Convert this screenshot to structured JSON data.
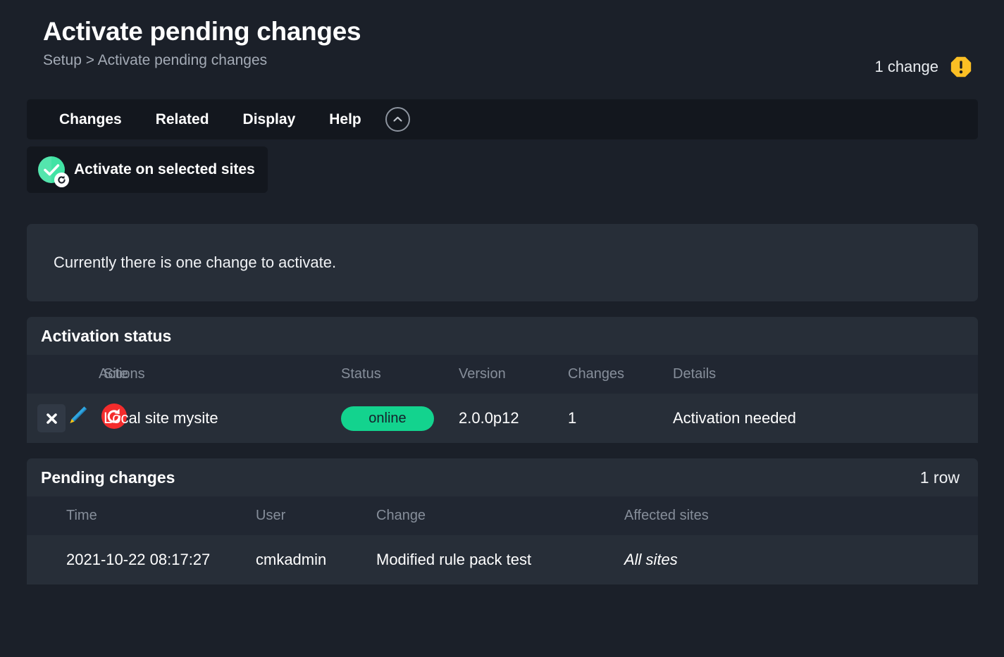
{
  "header": {
    "title": "Activate pending changes",
    "breadcrumb": "Setup > Activate pending changes",
    "change_count": "1 change",
    "warning_icon": "warning-octagon-icon",
    "warning_color": "#fbbf24"
  },
  "menu": {
    "items": [
      {
        "label": "Changes"
      },
      {
        "label": "Related"
      },
      {
        "label": "Display"
      },
      {
        "label": "Help"
      }
    ],
    "collapse_icon": "chevron-up-circle-icon"
  },
  "toolbar": {
    "activate_label": "Activate on selected sites",
    "activate_icon": "activate-check-reload-icon",
    "activate_icon_color": "#41e3a4"
  },
  "info": {
    "message": "Currently there is one change to activate."
  },
  "activation_status": {
    "title": "Activation status",
    "columns": [
      "Actions",
      "Site",
      "Status",
      "Version",
      "Changes",
      "Details"
    ],
    "rows": [
      {
        "delete_icon": "close-x-icon",
        "edit_icon": "pencil-icon",
        "restart_icon": "restart-circle-icon",
        "site": "Local site mysite",
        "status": "online",
        "status_color": "#13d38e",
        "version": "2.0.0p12",
        "changes": "1",
        "details": "Activation needed"
      }
    ]
  },
  "pending_changes": {
    "title": "Pending changes",
    "row_count": "1 row",
    "columns": [
      "Time",
      "User",
      "Change",
      "Affected sites"
    ],
    "rows": [
      {
        "time": "2021-10-22 08:17:27",
        "user": "cmkadmin",
        "change": "Modified rule pack test",
        "affected_sites": "All sites"
      }
    ]
  }
}
